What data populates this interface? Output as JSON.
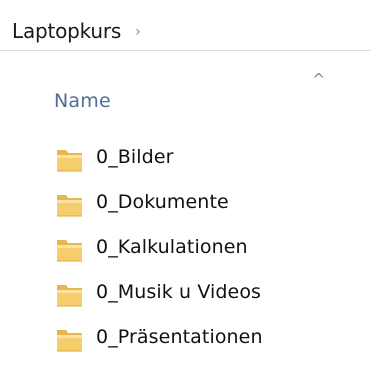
{
  "breadcrumb": {
    "items": [
      {
        "label": "Laptopkurs"
      }
    ],
    "separator": "›"
  },
  "columns": {
    "name_label": "Name",
    "sort_indicator": "^"
  },
  "files": [
    {
      "name": "0_Bilder",
      "type": "folder"
    },
    {
      "name": "0_Dokumente",
      "type": "folder"
    },
    {
      "name": "0_Kalkulationen",
      "type": "folder"
    },
    {
      "name": "0_Musik u Videos",
      "type": "folder"
    },
    {
      "name": "0_Präsentationen",
      "type": "folder"
    }
  ],
  "colors": {
    "folder_body": "#f5cd6c",
    "folder_light": "#fbe3a2",
    "folder_edge": "#d9a93f",
    "header_text": "#4f6e94"
  }
}
